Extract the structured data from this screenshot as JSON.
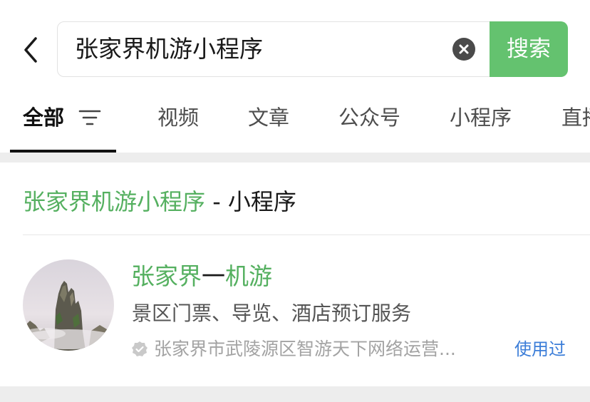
{
  "search": {
    "query": "张家界机游小程序",
    "button_label": "搜索"
  },
  "icons": {
    "back": "chevron-left-icon",
    "clear": "clear-circle-icon",
    "filter": "filter-lines-icon",
    "verified": "verified-badge-icon"
  },
  "tabs": [
    {
      "label": "全部",
      "active": true
    },
    {
      "label": "视频",
      "active": false
    },
    {
      "label": "文章",
      "active": false
    },
    {
      "label": "公众号",
      "active": false
    },
    {
      "label": "小程序",
      "active": false
    },
    {
      "label": "直播",
      "active": false
    }
  ],
  "section": {
    "title_highlight": "张家界机游小程序",
    "title_rest": " - 小程序"
  },
  "result": {
    "name_part1": "张家界",
    "name_part2": "一",
    "name_part3": "机游",
    "description": "景区门票、导览、酒店预订服务",
    "owner": "张家界市武陵源区智游天下网络运营...",
    "used_label": "使用过"
  },
  "colors": {
    "accent_green": "#64c26f",
    "highlight_green": "#55b060",
    "link_blue": "#3b7dd8",
    "band_gray": "#ededed"
  }
}
